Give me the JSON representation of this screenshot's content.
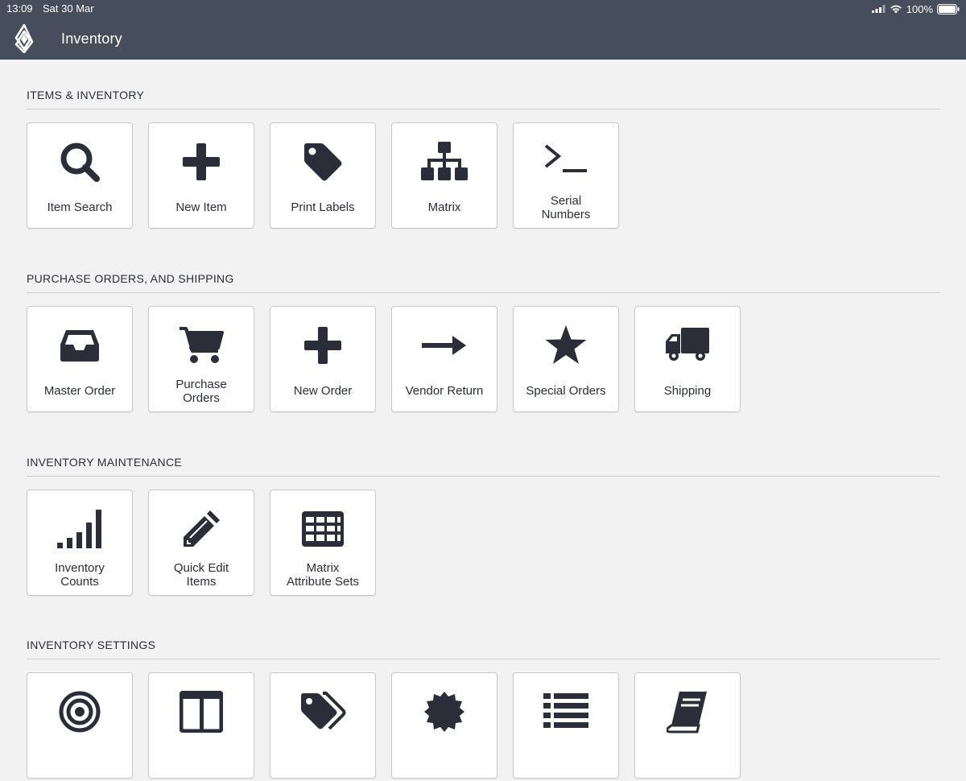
{
  "status": {
    "time": "13:09",
    "date": "Sat 30 Mar",
    "battery": "100%"
  },
  "header": {
    "title": "Inventory"
  },
  "sections": [
    {
      "title": "ITEMS & INVENTORY",
      "tiles": [
        {
          "label": "Item Search",
          "icon": "search-icon"
        },
        {
          "label": "New Item",
          "icon": "plus-icon"
        },
        {
          "label": "Print Labels",
          "icon": "tag-icon"
        },
        {
          "label": "Matrix",
          "icon": "sitemap-icon"
        },
        {
          "label_line1": "Serial",
          "label_line2": "Numbers",
          "icon": "terminal-icon"
        }
      ]
    },
    {
      "title": "PURCHASE ORDERS, AND SHIPPING",
      "tiles": [
        {
          "label": "Master Order",
          "icon": "inbox-icon"
        },
        {
          "label_line1": "Purchase",
          "label_line2": "Orders",
          "icon": "cart-icon"
        },
        {
          "label": "New Order",
          "icon": "plus-icon"
        },
        {
          "label": "Vendor Return",
          "icon": "arrow-right-icon"
        },
        {
          "label": "Special Orders",
          "icon": "star-icon"
        },
        {
          "label": "Shipping",
          "icon": "truck-icon"
        }
      ]
    },
    {
      "title": "INVENTORY MAINTENANCE",
      "tiles": [
        {
          "label_line1": "Inventory",
          "label_line2": "Counts",
          "icon": "signal-bars-icon"
        },
        {
          "label_line1": "Quick Edit",
          "label_line2": "Items",
          "icon": "pencil-icon"
        },
        {
          "label_line1": "Matrix",
          "label_line2": "Attribute Sets",
          "icon": "grid-table-icon"
        }
      ]
    },
    {
      "title": "INVENTORY SETTINGS",
      "tiles": [
        {
          "icon": "bullseye-icon"
        },
        {
          "icon": "columns-icon"
        },
        {
          "icon": "tags-icon"
        },
        {
          "icon": "certificate-icon"
        },
        {
          "icon": "list-icon"
        },
        {
          "icon": "book-icon"
        }
      ]
    }
  ],
  "colors": {
    "header_bg": "#474e5b",
    "icon": "#2b2e38",
    "page_bg": "#f2f2f2"
  }
}
